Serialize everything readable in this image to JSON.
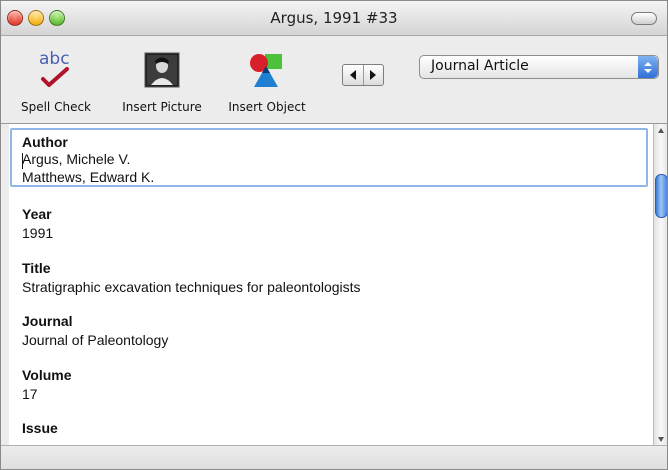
{
  "window": {
    "title": "Argus, 1991 #33"
  },
  "toolbar": {
    "spell_check": {
      "label": "Spell Check",
      "icon": "spell-check-icon",
      "glyph": "abc"
    },
    "insert_picture": {
      "label": "Insert Picture",
      "icon": "insert-picture-icon"
    },
    "insert_object": {
      "label": "Insert Object",
      "icon": "insert-object-icon"
    }
  },
  "reference_type": {
    "value": "Journal Article"
  },
  "fields": [
    {
      "name": "Author",
      "values": [
        "Argus, Michele V.",
        "Matthews, Edward K."
      ]
    },
    {
      "name": "Year",
      "values": [
        "1991"
      ]
    },
    {
      "name": "Title",
      "values": [
        "Stratigraphic excavation techniques for paleontologists"
      ]
    },
    {
      "name": "Journal",
      "values": [
        "Journal of Paleontology"
      ]
    },
    {
      "name": "Volume",
      "values": [
        "17"
      ]
    },
    {
      "name": "Issue",
      "values": []
    }
  ],
  "colors": {
    "focus_ring": "#8fb6e6",
    "scroll_thumb": "#3a78d6",
    "popup_arrows": "#2f6fd8"
  }
}
